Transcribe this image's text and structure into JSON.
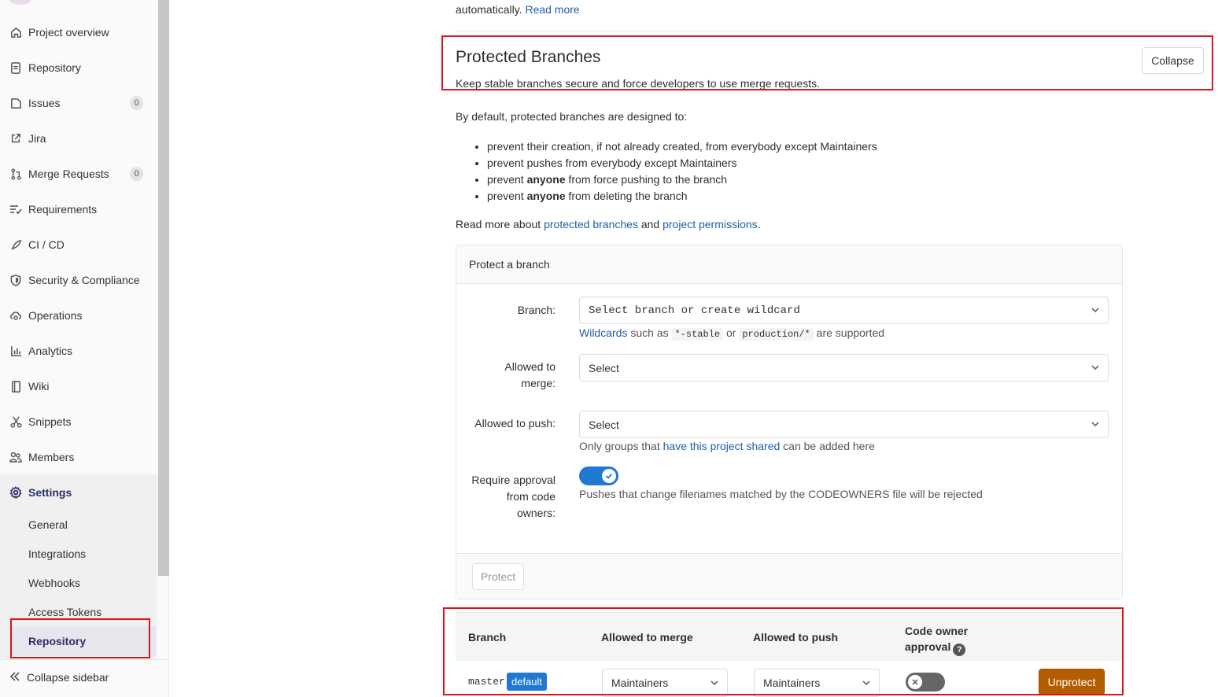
{
  "sidebar": {
    "items": [
      {
        "label": "Project overview",
        "icon": "home-icon"
      },
      {
        "label": "Repository",
        "icon": "document-icon"
      },
      {
        "label": "Issues",
        "icon": "issues-icon",
        "count": "0"
      },
      {
        "label": "Jira",
        "icon": "external-link-icon"
      },
      {
        "label": "Merge Requests",
        "icon": "merge-request-icon",
        "count": "0"
      },
      {
        "label": "Requirements",
        "icon": "requirements-icon"
      },
      {
        "label": "CI / CD",
        "icon": "rocket-icon"
      },
      {
        "label": "Security & Compliance",
        "icon": "shield-icon"
      },
      {
        "label": "Operations",
        "icon": "cloud-gear-icon"
      },
      {
        "label": "Analytics",
        "icon": "chart-icon"
      },
      {
        "label": "Wiki",
        "icon": "book-icon"
      },
      {
        "label": "Snippets",
        "icon": "scissors-icon"
      },
      {
        "label": "Members",
        "icon": "users-icon"
      },
      {
        "label": "Settings",
        "icon": "gear-icon"
      }
    ],
    "settings_sub": [
      "General",
      "Integrations",
      "Webhooks",
      "Access Tokens",
      "Repository"
    ],
    "collapse_label": "Collapse sidebar"
  },
  "top": {
    "prefix": "automatically.",
    "read_more": "Read more"
  },
  "section": {
    "title": "Protected Branches",
    "subtitle": "Keep stable branches secure and force developers to use merge requests.",
    "collapse_label": "Collapse",
    "intro": "By default, protected branches are designed to:",
    "bullets": [
      {
        "pre": "prevent their creation, if not already created, from everybody except Maintainers",
        "bold": "",
        "post": ""
      },
      {
        "pre": "prevent pushes from everybody except Maintainers",
        "bold": "",
        "post": ""
      },
      {
        "pre": "prevent ",
        "bold": "anyone",
        "post": " from force pushing to the branch"
      },
      {
        "pre": "prevent ",
        "bold": "anyone",
        "post": " from deleting the branch"
      }
    ],
    "read_more_pre": "Read more about ",
    "link1": "protected branches",
    "and": " and ",
    "link2": "project permissions",
    "period": "."
  },
  "form": {
    "header": "Protect a branch",
    "branch_label": "Branch:",
    "branch_placeholder": "Select branch or create wildcard",
    "wildcards_link": "Wildcards",
    "wildcards_mid1": " such as ",
    "wildcard1": "*-stable",
    "wildcards_mid2": " or ",
    "wildcard2": "production/*",
    "wildcards_post": " are supported",
    "merge_label_1": "Allowed to",
    "merge_label_2": "merge:",
    "merge_value": "Select",
    "push_label": "Allowed to push:",
    "push_value": "Select",
    "push_help_pre": "Only groups that ",
    "push_help_link": "have this project shared",
    "push_help_post": " can be added here",
    "approval_label_1": "Require approval",
    "approval_label_2": "from code",
    "approval_label_3": "owners:",
    "approval_help": "Pushes that change filenames matched by the CODEOWNERS file will be rejected",
    "approval_on": true,
    "protect_label": "Protect"
  },
  "table": {
    "headers": {
      "branch": "Branch",
      "merge": "Allowed to merge",
      "push": "Allowed to push",
      "owner_1": "Code owner",
      "owner_2": "approval",
      "help": "?"
    },
    "rows": [
      {
        "branch": "master",
        "badge": "default",
        "merge": "Maintainers",
        "push": "Maintainers",
        "code_owner_approval": false,
        "action": "Unprotect"
      }
    ]
  },
  "colors": {
    "link": "#1f5fa8",
    "toggle_on": "#1f78d1",
    "unprotect": "#b35d00",
    "highlight": "#e0121b"
  }
}
